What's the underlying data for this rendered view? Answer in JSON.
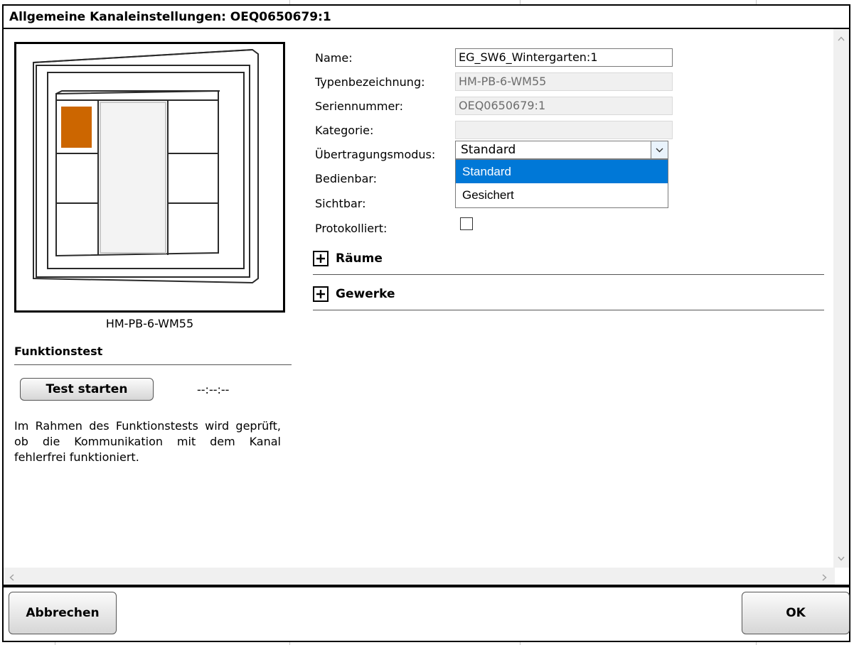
{
  "dialog": {
    "title": "Allgemeine Kanaleinstellungen: OEQ0650679:1"
  },
  "device": {
    "type_caption": "HM-PB-6-WM55",
    "active_button_color": "#cc6600"
  },
  "function_test": {
    "title": "Funktionstest",
    "start_label": "Test starten",
    "timer": "--:--:--",
    "description": "Im Rahmen des Funktionstests wird geprüft, ob die Kommunikation mit dem Kanal fehlerfrei funktioniert."
  },
  "form": {
    "name_label": "Name:",
    "name_value": "EG_SW6_Wintergarten:1",
    "type_label": "Typenbezeichnung:",
    "type_value": "HM-PB-6-WM55",
    "serial_label": "Seriennummer:",
    "serial_value": "OEQ0650679:1",
    "category_label": "Kategorie:",
    "category_value": "",
    "mode_label": "Übertragungsmodus:",
    "mode_value": "Standard",
    "mode_options": [
      "Standard",
      "Gesichert"
    ],
    "operable_label": "Bedienbar:",
    "visible_label": "Sichtbar:",
    "logged_label": "Protokolliert:",
    "logged_checked": false
  },
  "expanders": {
    "rooms": "Räume",
    "trades": "Gewerke"
  },
  "footer": {
    "cancel": "Abbrechen",
    "ok": "OK"
  },
  "colors": {
    "selection": "#0078d7",
    "border": "#000000"
  }
}
